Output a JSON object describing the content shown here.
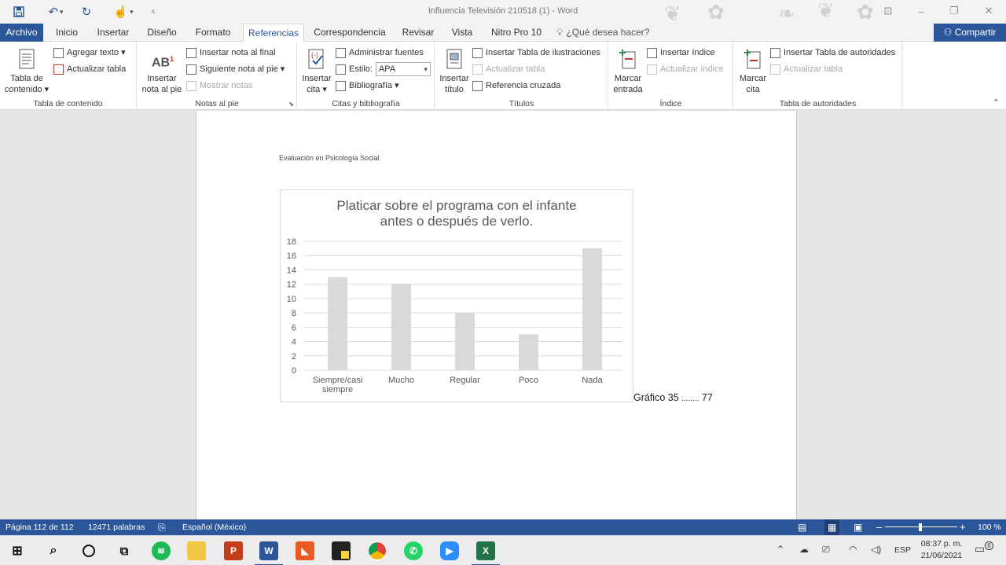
{
  "window": {
    "title": "Influencia Televisión 210518 (1) - Word"
  },
  "tabs": {
    "archivo": "Archivo",
    "inicio": "Inicio",
    "insertar": "Insertar",
    "diseno": "Diseño",
    "formato": "Formato",
    "referencias": "Referencias",
    "correspondencia": "Correspondencia",
    "revisar": "Revisar",
    "vista": "Vista",
    "nitro": "Nitro Pro 10",
    "tell_me": "¿Qué desea hacer?",
    "share": "Compartir"
  },
  "ribbon": {
    "toc": {
      "table_button_1": "Tabla de",
      "table_button_2": "contenido ▾",
      "add_text": "Agregar texto ▾",
      "update_table": "Actualizar tabla",
      "label": "Tabla de contenido"
    },
    "footnotes": {
      "insert_1": "Insertar",
      "insert_2": "nota al pie",
      "insert_endnote": "Insertar nota al final",
      "next_footnote": "Siguiente nota al pie  ▾",
      "show_notes": "Mostrar notas",
      "label": "Notas al pie"
    },
    "citations": {
      "insert_1": "Insertar",
      "insert_2": "cita ▾",
      "manage_sources": "Administrar fuentes",
      "style_label": "Estilo:",
      "style_value": "APA",
      "bibliography": "Bibliografía ▾",
      "label": "Citas y bibliografía"
    },
    "captions": {
      "insert_1": "Insertar",
      "insert_2": "título",
      "insert_table_figures": "Insertar Tabla de ilustraciones",
      "update_table": "Actualizar tabla",
      "cross_reference": "Referencia cruzada",
      "label": "Títulos"
    },
    "index": {
      "mark_1": "Marcar",
      "mark_2": "entrada",
      "insert_index": "Insertar índice",
      "update_index": "Actualizar índice",
      "label": "Índice"
    },
    "authorities": {
      "mark_1": "Marcar",
      "mark_2": "cita",
      "insert_table": "Insertar Tabla de autoridades",
      "update_table": "Actualizar tabla",
      "label": "Tabla de autoridades"
    }
  },
  "document": {
    "header": "Evaluación en Psicología Social",
    "caption_text": "Gráfico 35",
    "caption_dots": "........",
    "caption_page": "77"
  },
  "chart_data": {
    "type": "bar",
    "title": "Platicar sobre el programa con el infante antes o después de verlo.",
    "title_lines": [
      "Platicar sobre el programa con el infante",
      "antes o después de verlo."
    ],
    "categories": [
      "Siempre/casi siempre",
      "Mucho",
      "Regular",
      "Poco",
      "Nada"
    ],
    "category_lines": [
      [
        "Siempre/casi",
        "siempre"
      ],
      [
        "Mucho"
      ],
      [
        "Regular"
      ],
      [
        "Poco"
      ],
      [
        "Nada"
      ]
    ],
    "values": [
      13,
      12,
      8,
      5,
      17
    ],
    "ylim": [
      0,
      18
    ],
    "yticks": [
      0,
      2,
      4,
      6,
      8,
      10,
      12,
      14,
      16,
      18
    ],
    "grid": true,
    "bar_color": "#d9d9d9",
    "xlabel": "",
    "ylabel": ""
  },
  "statusbar": {
    "page": "Página 112 de 112",
    "words": "12471 palabras",
    "language": "Español (México)",
    "zoom": "100 %"
  },
  "taskbar": {
    "lang": "ESP",
    "time": "08:37 p. m.",
    "date": "21/06/2021",
    "notifications": "6"
  },
  "colors": {
    "accent": "#2b579a"
  }
}
